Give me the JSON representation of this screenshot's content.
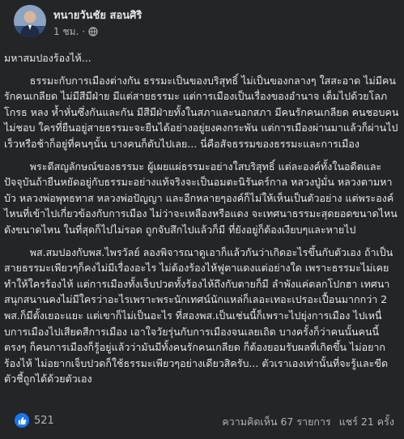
{
  "post": {
    "author": "ทนายวันชัย สอนศิริ",
    "time": "1 ชม.",
    "privacy_icon": "globe-icon",
    "paragraphs": [
      "มหาสมปองร้องไห้...",
      "        ธรรมะกับการเมืองต่างกัน ธรรมะเป็นของบริสุทธิ์ ไม่เป็นของกลางๆ ใสสะอาด ไม่มีคนรักคนเกลียด ไม่มีสีมีฝ่าย มีแต่สายธรรมะ แต่การเมืองเป็นเรื่องของอำนาจ เต็มไปด้วยโลภ โกรธ หลง ห้ำหั่นซึ่งกันและกัน มีสีมีฝ่ายทั้งในสภาและนอกสภา มีคนรักคนเกลียด คนชอบคนไม่ชอบ ใครที่ยืนอยู่สายธรรมะจะยืนได้อย่างอยู่ยงคงกระพัน แต่การเมืองผ่านมาแล้วก็ผ่านไป เร็วหรือช้าก็อยู่ที่คนๆนั้น บางคนก็ดับไปเลย... นี่คือสัจธรรมของธรรมะและการเมือง",
      "        พระดีสญลักษณ์ของธรรมะ ผู้เผยแผ่ธรรมะอย่างใสบริสุทธิ์ แต่ละองค์ทั้งในอดีตและปัจจุบันถ้ายืนหยัดอยู่กับธรรมะอย่างแท้จริงจะเป็นอมตะนิรันดร์กาล หลวงปู่มั่น หลวงตามหาบัว หลวงพ่อพุทธทาส หลวงพ่อปัญญา และอีกหลายๆองค์ก็ไม่ให้เห็นเป็นตัวอย่าง แต่พระองค์ไหนที่เข้าไปเกี่ยวข้องกับการเมือง ไม่ว่าจะเหลืองหรือแดง จะเทศนาธรรมะสุดยอดขนาดไหน ดังขนาดไหน ในที่สุดก็ไปไม่รอด ถูกจับสึกไปแล้วก็มี ที่ยังอยู่ก็ต้องเงียบๆและหายไป",
      "        พส.สมปองกับพส.ไพรวัลย์ ลองพิจารณาดูเอาก็แล้วกันว่าเกิดอะไรขึ้นกับตัวเอง ถ้าเป็นสายธรรมะเพียวๆก็คงไม่มีเรื่องอะไร ไม่ต้องร้องไห้ฟูตาแดงแต่อย่างใด เพราะธรรมะไม่เคยทำให้ใครร้องไห้ แต่การเมืองทั้งเจ็บปวดทั้งร้องไห้ถึงกับตายก็มี ลำพังแค่ตลกโปกฮา เทศนาสนุกสนานคงไม่มีใครว่าอะไรเพราะพระนักเทศน์นักแหล่ก็เลอะเทอะเปรอะเปื้อนมากกว่า 2 พส.ก็มีตั้งเยอะแยะ แต่เขาก็ไม่เป็นอะไร ที่สองพส.เป็นเช่นนี้ก็เพราะไปยุ่งการเมือง ไปเหนื่บการเมืองไปเสียดสีการเมือง เอาใจวัยรุ่นกับการเมืองจนเลยเถิด บางครั้งก็ว่าคนนั้นคนนี้ตรงๆ ก็คนการเมืองก็รู้อยู่แล้วว่ามันมีทั้งคนรักคนเกลียด ก็ต้องยอมรับผลที่เกิดขึ้น ไม่อยากร้องไห้ ไม่อยากเจ็บปวดก็ใช้ธรรมะเพียวๆอย่างเดียวสิครับ... ตัวเราเองเท่านั้นที่จะรู้และขีดตัวชี้ถูกได้ด้วยตัวเอง"
    ]
  },
  "footer": {
    "reaction_icon": "thumbs-up-icon",
    "reaction_count": "521",
    "comments": "ความคิดเห็น 67 รายการ",
    "shares": "แชร์ 21 ครั้ง"
  },
  "colors": {
    "background": "#242526",
    "text_primary": "#e4e6eb",
    "text_secondary": "#b0b3b8",
    "like_blue": "#1877f2"
  }
}
